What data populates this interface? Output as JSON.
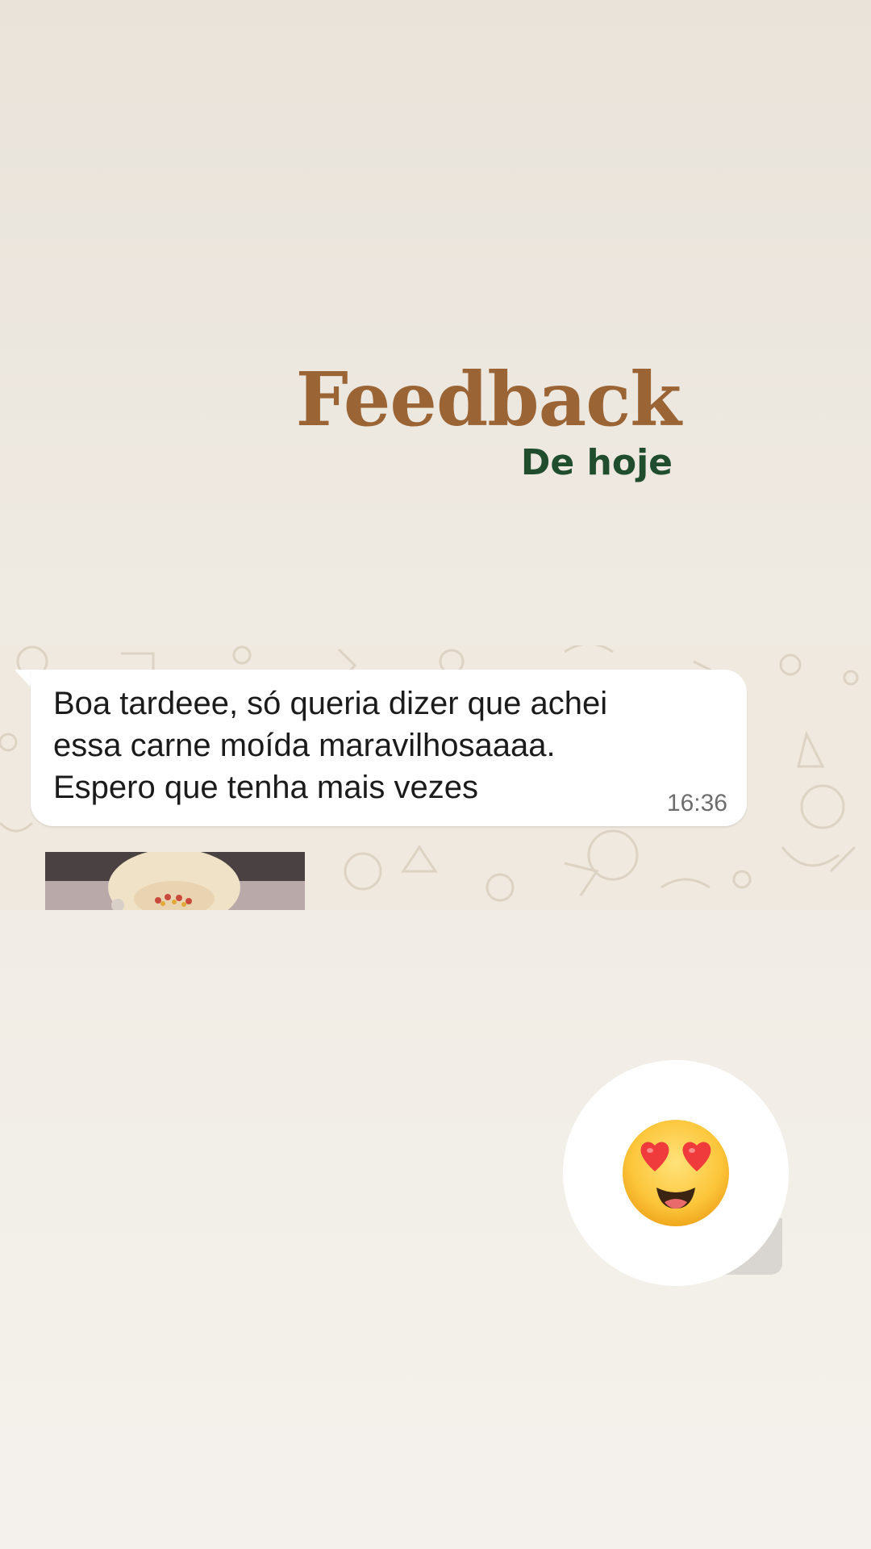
{
  "heading": {
    "title": "Feedback",
    "subtitle": "De hoje"
  },
  "colors": {
    "title": "#9a6435",
    "subtitle": "#1f4d2e",
    "bubble": "#ffffff",
    "chat_background": "#efe9df"
  },
  "message": {
    "lines": [
      "Boa tardeee, só queria dizer que achei",
      "essa carne moída maravilhosaaaa.",
      "Espero que tenha mais vezes"
    ],
    "time": "16:36"
  },
  "media": {
    "icon": "photo-thumbnail"
  },
  "reaction": {
    "emoji": "heart-eyes-emoji"
  }
}
